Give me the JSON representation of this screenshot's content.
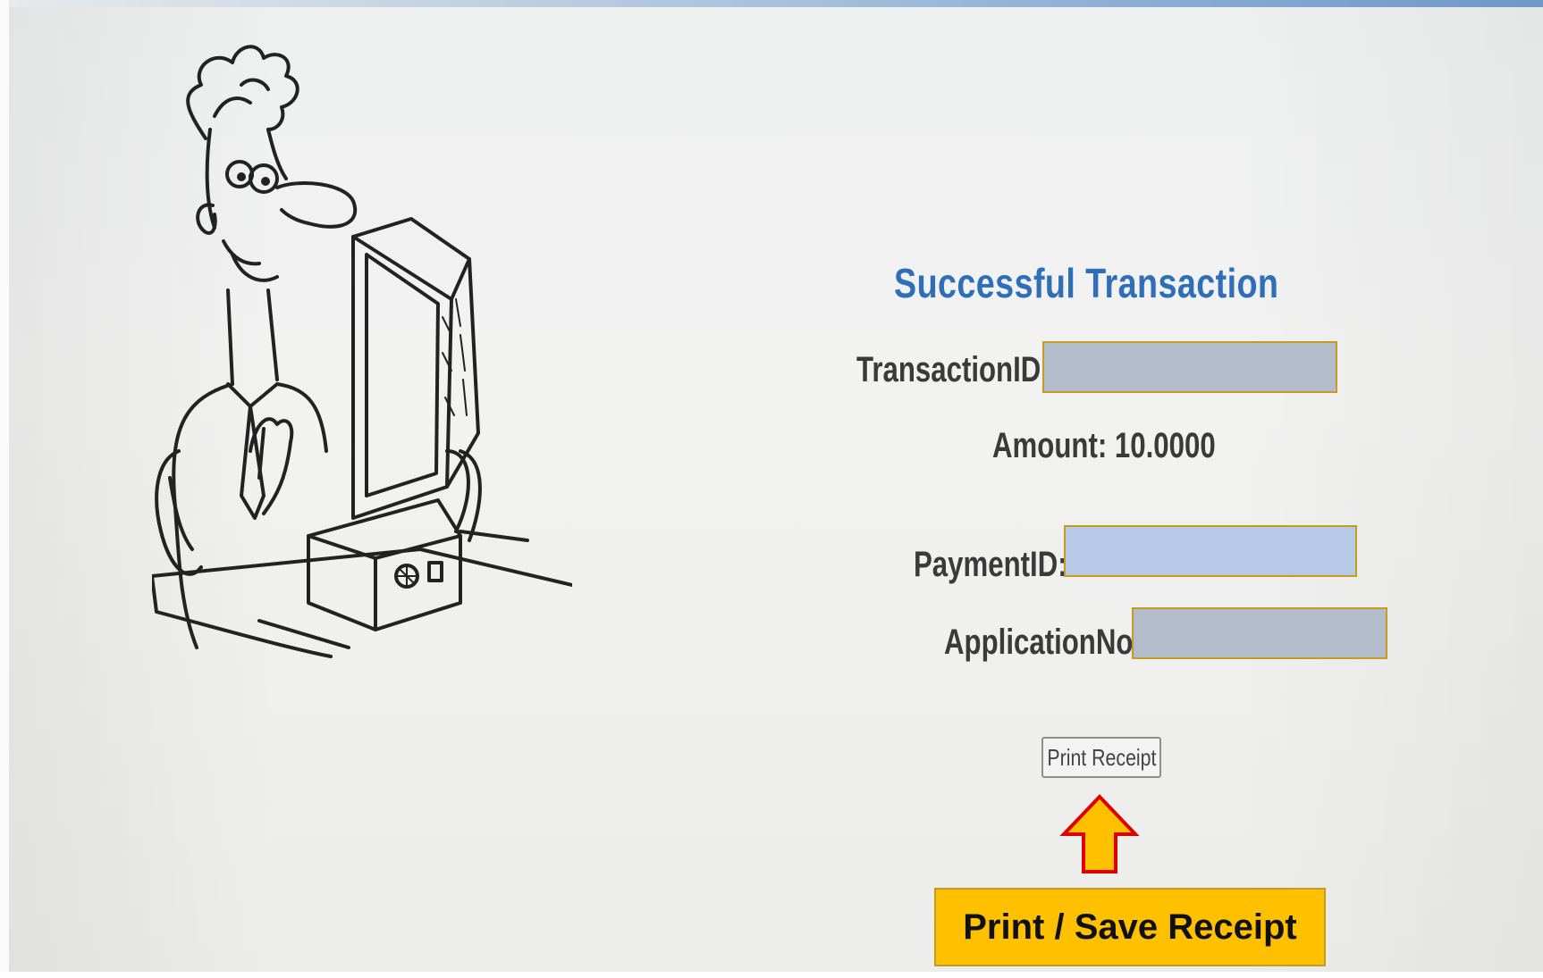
{
  "page": {
    "title": "Successful Transaction"
  },
  "fields": {
    "transaction_id_label": "TransactionID:",
    "amount_label": "Amount: 10.0000",
    "payment_id_label": "PaymentID:",
    "application_no_label": "ApplicationNo:"
  },
  "actions": {
    "print_receipt_label": "Print Receipt"
  },
  "annotation": {
    "callout_text": "Print / Save Receipt",
    "arrow_icon": "up-arrow-icon"
  },
  "colors": {
    "title": "#2e6fb7",
    "callout_fill": "#ffc000",
    "arrow_fill": "#ffc000",
    "arrow_stroke": "#e00000",
    "redaction_gray": "#b3bccb",
    "redaction_blue": "#b6c9e6",
    "redaction_border": "#c89a1d"
  }
}
